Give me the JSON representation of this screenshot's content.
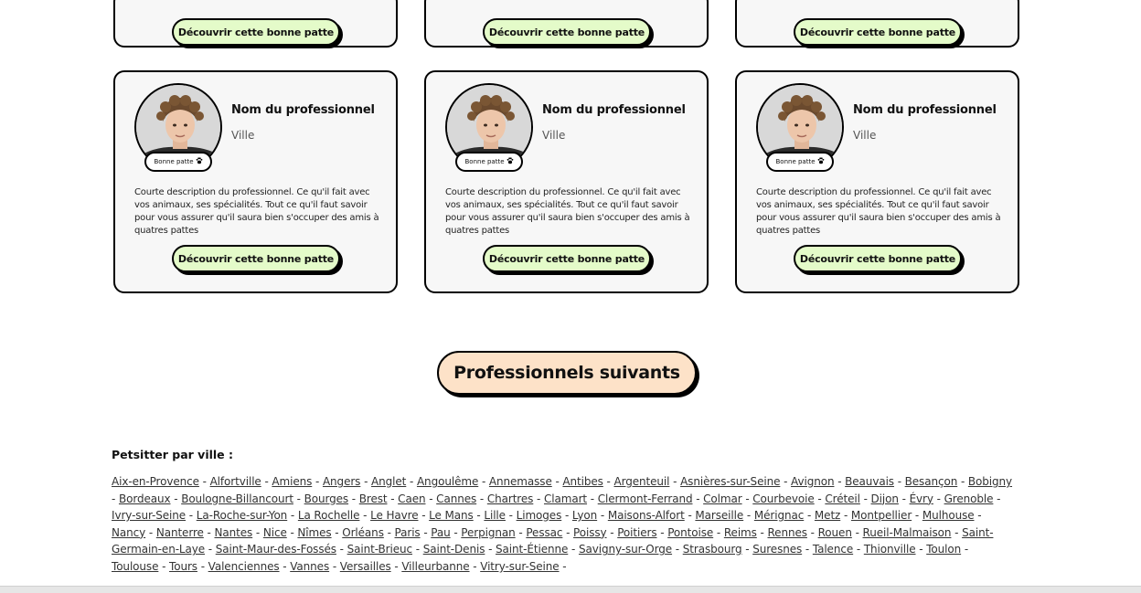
{
  "cards_top": [
    {
      "button": "Découvrir cette bonne patte"
    },
    {
      "button": "Découvrir cette bonne patte"
    },
    {
      "button": "Découvrir cette bonne patte"
    }
  ],
  "cards": [
    {
      "name": "Nom du professionnel",
      "city": "Ville",
      "badge": "Bonne patte",
      "description": "Courte description du professionnel. Ce qu'il fait avec vos animaux, ses spécialités. Tout ce qu'il faut savoir pour vous assurer qu'il saura bien s'occuper des amis à quatres pattes",
      "button": "Découvrir cette bonne patte"
    },
    {
      "name": "Nom du professionnel",
      "city": "Ville",
      "badge": "Bonne patte",
      "description": "Courte description du professionnel. Ce qu'il fait avec vos animaux, ses spécialités. Tout ce qu'il faut savoir pour vous assurer qu'il saura bien s'occuper des amis à quatres pattes",
      "button": "Découvrir cette bonne patte"
    },
    {
      "name": "Nom du professionnel",
      "city": "Ville",
      "badge": "Bonne patte",
      "description": "Courte description du professionnel. Ce qu'il fait avec vos animaux, ses spécialités. Tout ce qu'il faut savoir pour vous assurer qu'il saura bien s'occuper des amis à quatres pattes",
      "button": "Découvrir cette bonne patte"
    }
  ],
  "next_button": "Professionnels suivants",
  "cities_title": "Petsitter par ville :",
  "cities": [
    "Aix-en-Provence",
    "Alfortville",
    "Amiens",
    "Angers",
    "Anglet",
    "Angoulême",
    "Annemasse",
    "Antibes",
    "Argenteuil",
    "Asnières-sur-Seine",
    "Avignon",
    "Beauvais",
    "Besançon",
    "Bobigny",
    "Bordeaux",
    "Boulogne-Billancourt",
    "Bourges",
    "Brest",
    "Caen",
    "Cannes",
    "Chartres",
    "Clamart",
    "Clermont-Ferrand",
    "Colmar",
    "Courbevoie",
    "Créteil",
    "Dijon",
    "Évry",
    "Grenoble",
    "Ivry-sur-Seine",
    "La-Roche-sur-Yon",
    "La Rochelle",
    "Le Havre",
    "Le Mans",
    "Lille",
    "Limoges",
    "Lyon",
    "Maisons-Alfort",
    "Marseille",
    "Mérignac",
    "Metz",
    "Montpellier",
    "Mulhouse",
    "Nancy",
    "Nanterre",
    "Nantes",
    "Nice",
    "Nîmes",
    "Orléans",
    "Paris",
    "Pau",
    "Perpignan",
    "Pessac",
    "Poissy",
    "Poitiers",
    "Pontoise",
    "Reims",
    "Rennes",
    "Rouen",
    "Rueil-Malmaison",
    "Saint-Germain-en-Laye",
    "Saint-Maur-des-Fossés",
    "Saint-Brieuc",
    "Saint-Denis",
    "Saint-Étienne",
    "Savigny-sur-Orge",
    "Strasbourg",
    "Suresnes",
    "Talence",
    "Thionville",
    "Toulon",
    "Toulouse",
    "Tours",
    "Valenciennes",
    "Vannes",
    "Versailles",
    "Villeurbanne",
    "Vitry-sur-Seine"
  ],
  "separator": "-",
  "colors": {
    "button_green": "#e4fbc9",
    "button_peach": "#fde2c8",
    "card_bg": "#f7f7f7"
  },
  "icons": {
    "badge_icon": "paw-icon"
  }
}
